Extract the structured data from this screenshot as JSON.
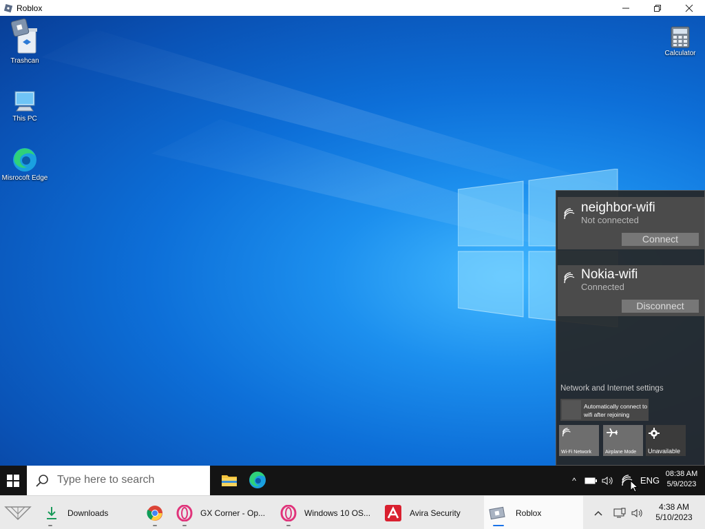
{
  "window": {
    "title": "Roblox",
    "minimize_icon": "minimize-icon",
    "restore_icon": "restore-icon",
    "close_icon": "close-icon"
  },
  "desktop": {
    "icons": [
      {
        "label": "Trashcan",
        "icon": "trashcan-icon"
      },
      {
        "label": "This PC",
        "icon": "this-pc-icon"
      },
      {
        "label": "Misrocoft Edge",
        "icon": "edge-icon"
      },
      {
        "label": "Calculator",
        "icon": "calculator-icon"
      }
    ]
  },
  "wifi_panel": {
    "networks": [
      {
        "name": "neighbor-wifi",
        "status": "Not connected",
        "action": "Connect"
      },
      {
        "name": "Nokia-wifi",
        "status": "Connected",
        "action": "Disconnect"
      }
    ],
    "settings_title": "Network and Internet settings",
    "auto_connect_label": "Automatically connect to wifi after rejoining",
    "tiles": [
      {
        "label": "Wi-Fi Network",
        "icon": "wifi-icon"
      },
      {
        "label": "Airplane Mode",
        "icon": "airplane-icon"
      },
      {
        "label": "Unavailable",
        "icon": "gear-icon"
      }
    ]
  },
  "taskbar": {
    "search_placeholder": "Type here to search",
    "pinned": [
      {
        "icon": "file-explorer-icon"
      },
      {
        "icon": "edge-icon"
      }
    ],
    "tray": {
      "chevron": "^",
      "language": "ENG",
      "time": "08:38 AM",
      "date": "5/9/2023"
    }
  },
  "host_taskbar": {
    "items": [
      {
        "label": "Downloads",
        "icon": "download-icon"
      },
      {
        "label": "",
        "icon": "chrome-icon"
      },
      {
        "label": "GX Corner - Op...",
        "icon": "opera-gx-icon"
      },
      {
        "label": "Windows 10 OS...",
        "icon": "opera-icon"
      },
      {
        "label": "Avira Security",
        "icon": "avira-icon"
      },
      {
        "label": "Roblox",
        "icon": "roblox-icon"
      }
    ],
    "time": "4:38 AM",
    "date": "5/10/2023"
  },
  "colors": {
    "desktop_blue": "#1c8fee",
    "panel_bg": "#262626",
    "card_bg": "#4b4b4b",
    "taskbar_dark": "#141414",
    "taskbar_light": "#eaeaea"
  }
}
